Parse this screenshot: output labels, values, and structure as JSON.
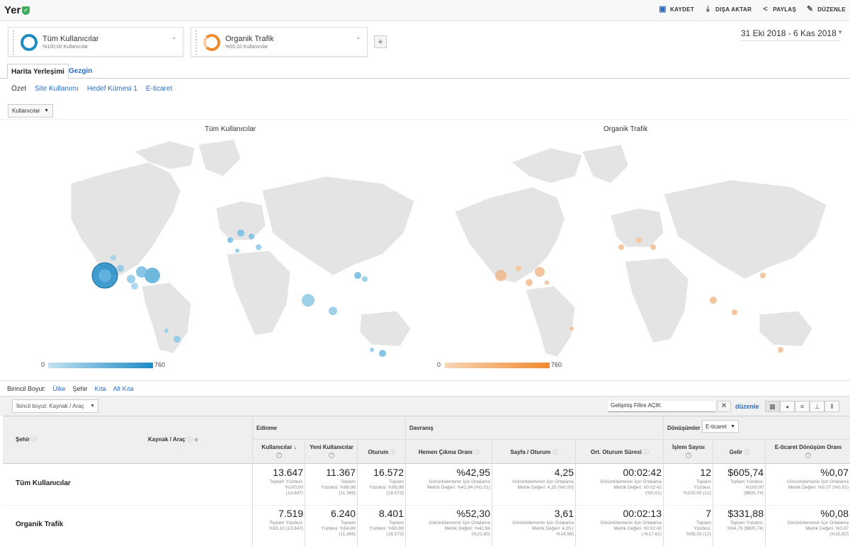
{
  "header": {
    "title": "Yer",
    "actions": [
      {
        "label": "KAYDET",
        "icon": "save-icon"
      },
      {
        "label": "DIŞA AKTAR",
        "icon": "export-icon"
      },
      {
        "label": "PAYLAŞ",
        "icon": "share-icon"
      },
      {
        "label": "DÜZENLE",
        "icon": "edit-icon"
      }
    ]
  },
  "segments": [
    {
      "name": "Tüm Kullanıcılar",
      "sub": "%100,00 Kullanıcılar",
      "color": "#1e8bc3"
    },
    {
      "name": "Organik Trafik",
      "sub": "%55,10 Kullanıcılar",
      "color": "#ef8a2d"
    }
  ],
  "date_range": "31 Eki 2018 - 6 Kas 2018",
  "tabs": [
    "Harita Yerleşimi",
    "Gezgin"
  ],
  "subnav": [
    "Özet",
    "Site Kullanımı",
    "Hedef Kümesi 1",
    "E-ticaret"
  ],
  "metric_selector": "Kullanıcılar",
  "maps": [
    {
      "title": "Tüm Kullanıcılar",
      "legend_min": "0",
      "legend_max": "760",
      "color": "#1e8bc3"
    },
    {
      "title": "Organik Trafik",
      "legend_min": "0",
      "legend_max": "760",
      "color": "#ef8a2d"
    }
  ],
  "primary_dimension": {
    "label": "Birincil Boyut:",
    "options": [
      "Ülke",
      "Şehir",
      "Kıta",
      "Alt Kıta"
    ]
  },
  "secondary_dimension": "İkincil boyut: Kaynak / Araç",
  "advanced_filter": "Gelişmiş Filtre AÇIK",
  "edit_link": "düzenle",
  "table": {
    "dim1": "Şehir",
    "dim2": "Kaynak / Araç",
    "groups": [
      "Edinme",
      "Davranış",
      "Dönüşümler"
    ],
    "conversion_select": "E-ticaret",
    "columns": [
      "Kullanıcılar",
      "Yeni Kullanıcılar",
      "Oturum",
      "Hemen Çıkma Oranı",
      "Sayfa / Oturum",
      "Ort. Oturum Süresi",
      "İşlem Sayısı",
      "Gelir",
      "E-ticaret Dönüşüm Oranı"
    ],
    "rows": [
      {
        "label": "Tüm Kullanıcılar",
        "cells": [
          {
            "v": "13.647",
            "s": [
              "Toplam Yüzdesi:",
              "%100,00",
              "(13.647)"
            ]
          },
          {
            "v": "11.367",
            "s": [
              "Toplam",
              "Yüzdesi: %99,98",
              "(11.369)"
            ]
          },
          {
            "v": "16.572",
            "s": [
              "Toplam",
              "Yüzdesi: %99,99",
              "(16.573)"
            ]
          },
          {
            "v": "%42,95",
            "s": [
              "Görüntülemenin İçin Ortalama",
              "Metrik Değeri: %42,94 (%0,01)"
            ]
          },
          {
            "v": "4,25",
            "s": [
              "Görüntülemenin İçin Ortalama",
              "Metrik Değeri: 4,25 (%0,00)"
            ]
          },
          {
            "v": "00:02:42",
            "s": [
              "Görüntülemenin İçin Ortalama",
              "Metrik Değeri: 00:02:42",
              "(%0,01)"
            ]
          },
          {
            "v": "12",
            "s": [
              "Toplam",
              "Yüzdesi:",
              "%100,00 (12)"
            ]
          },
          {
            "v": "$605,74",
            "s": [
              "Toplam Yüzdesi:",
              "%100,00",
              "($605,74)"
            ]
          },
          {
            "v": "%0,07",
            "s": [
              "Görüntülemenin İçin Ortalama",
              "Metrik Değeri: %0,07 (%0,01)"
            ]
          }
        ]
      },
      {
        "label": "Organik Trafik",
        "cells": [
          {
            "v": "7.519",
            "s": [
              "Toplam Yüzdesi:",
              "%55,10 (13.647)"
            ]
          },
          {
            "v": "6.240",
            "s": [
              "Toplam",
              "Yüzdesi: %54,89",
              "(11.369)"
            ]
          },
          {
            "v": "8.401",
            "s": [
              "Toplam",
              "Yüzdesi: %50,69",
              "(16.573)"
            ]
          },
          {
            "v": "%52,30",
            "s": [
              "Görüntülemenin İçin Ortalama",
              "Metrik Değeri: %42,94",
              "(%21,80)"
            ]
          },
          {
            "v": "3,61",
            "s": [
              "Görüntülemenin İçin Ortalama",
              "Metrik Değeri: 4,25 (",
              "-%14,99)"
            ]
          },
          {
            "v": "00:02:13",
            "s": [
              "Görüntülemenin İçin Ortalama",
              "Metrik Değeri: 00:02:42",
              "(-%17,62)"
            ]
          },
          {
            "v": "7",
            "s": [
              "Toplam",
              "Yüzdesi:",
              "%58,33 (12)"
            ]
          },
          {
            "v": "$331,88",
            "s": [
              "Toplam Yüzdesi:",
              "%54,79 ($605,74)"
            ]
          },
          {
            "v": "%0,08",
            "s": [
              "Görüntülemenin İçin Ortalama",
              "Metrik Değeri: %0,07",
              "(%15,82)"
            ]
          }
        ]
      }
    ]
  }
}
